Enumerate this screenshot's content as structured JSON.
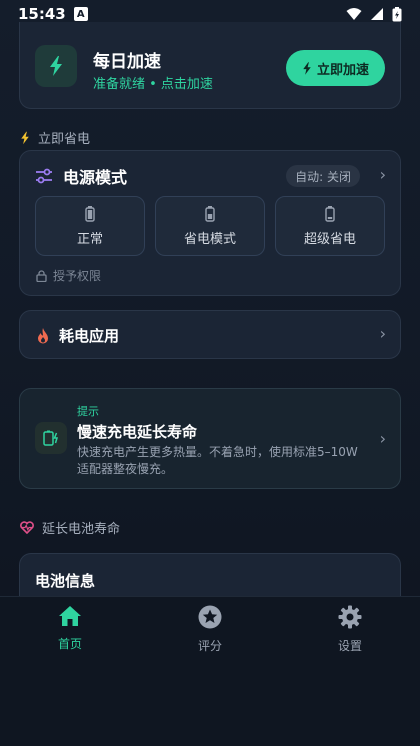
{
  "status_bar": {
    "time": "15:43",
    "notification_letter": "A"
  },
  "boost": {
    "title": "每日加速",
    "subtitle": "准备就绪 • 点击加速",
    "button_label": "立即加速"
  },
  "save_section": {
    "heading": "立即省电"
  },
  "power_mode": {
    "title": "电源模式",
    "auto_label": "自动: 关闭",
    "modes": [
      {
        "label": "正常"
      },
      {
        "label": "省电模式"
      },
      {
        "label": "超级省电"
      }
    ],
    "permission_label": "授予权限"
  },
  "drain_apps": {
    "title": "耗电应用"
  },
  "tip": {
    "label": "提示",
    "title": "慢速充电延长寿命",
    "body": "快速充电产生更多热量。不着急时，使用标准5–10W适配器整夜慢充。"
  },
  "extend_section": {
    "heading": "延长电池寿命"
  },
  "battery_info": {
    "title": "电池信息"
  },
  "nav": {
    "items": [
      {
        "label": "首页",
        "icon": "home-icon",
        "active": true
      },
      {
        "label": "评分",
        "icon": "star-icon",
        "active": false
      },
      {
        "label": "设置",
        "icon": "gear-icon",
        "active": false
      }
    ]
  },
  "colors": {
    "accent": "#2fd4a0",
    "background": "#141d2b",
    "card": "#1b2535",
    "heart": "#e0508a",
    "fire": "#ef6a50"
  }
}
